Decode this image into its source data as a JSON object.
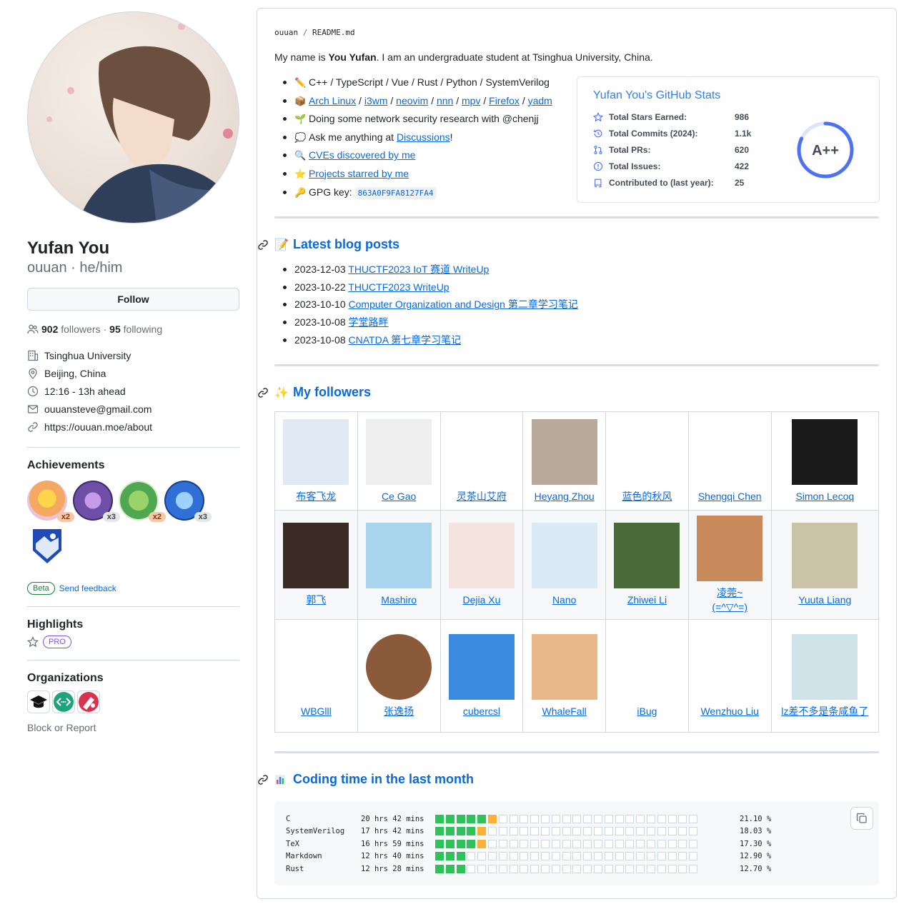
{
  "profile": {
    "name": "Yufan You",
    "username_pronouns": "ouuan · he/him",
    "follow_label": "Follow",
    "followers_count": "902",
    "followers_label": "followers",
    "separator": "·",
    "following_count": "95",
    "following_label": "following",
    "organization": "Tsinghua University",
    "location": "Beijing, China",
    "local_time": "12:16 - 13h ahead",
    "email": "ouuansteve@gmail.com",
    "website": "https://ouuan.moe/about"
  },
  "achievements": {
    "title": "Achievements",
    "badges": [
      {
        "name": "starstruck",
        "count": "x2",
        "color": "#f8c27a"
      },
      {
        "name": "galaxy-brain",
        "count": "x3",
        "color": "#7d5fb8"
      },
      {
        "name": "pair-extraordinaire",
        "count": "x2",
        "color": "#6cc26d"
      },
      {
        "name": "pull-shark",
        "count": "x3",
        "color": "#3a78d6"
      },
      {
        "name": "arctic-code-vault",
        "count": "",
        "color": "#2a61c7"
      }
    ],
    "beta_label": "Beta",
    "feedback_label": "Send feedback"
  },
  "highlights": {
    "title": "Highlights",
    "pro_label": "PRO"
  },
  "organizations": {
    "title": "Organizations",
    "block_label": "Block or Report"
  },
  "readme": {
    "path_user": "ouuan",
    "path_sep": "/",
    "path_file": "README.md",
    "intro_pre": "My name is ",
    "intro_name": "You Yufan",
    "intro_post": ". I am an undergraduate student at Tsinghua University, China.",
    "langs": "C++ / TypeScript / Vue / Rust / Python / SystemVerilog",
    "tools": [
      "Arch Linux",
      "i3wm",
      "neovim",
      "nnn",
      "mpv",
      "Firefox",
      "yadm"
    ],
    "tools_sep": " / ",
    "research": "Doing some network security research with @chenjj",
    "ask_pre": "Ask me anything at ",
    "ask_link": "Discussions",
    "ask_post": "!",
    "cves": "CVEs discovered by me",
    "starred": "Projects starred by me",
    "gpg_label": "GPG key: ",
    "gpg_key": "863A0F9FA8127FA4"
  },
  "stats_card": {
    "title": "Yufan You's GitHub Stats",
    "rows": [
      {
        "label": "Total Stars Earned:",
        "value": "986",
        "icon": "star-icon"
      },
      {
        "label": "Total Commits (2024):",
        "value": "1.1k",
        "icon": "history-icon"
      },
      {
        "label": "Total PRs:",
        "value": "620",
        "icon": "pull-request-icon"
      },
      {
        "label": "Total Issues:",
        "value": "422",
        "icon": "issue-icon"
      },
      {
        "label": "Contributed to (last year):",
        "value": "25",
        "icon": "repo-icon"
      }
    ],
    "grade": "A++",
    "ring_progress": 0.82
  },
  "blog": {
    "title": "Latest blog posts",
    "posts": [
      {
        "date": "2023-12-03",
        "title": "THUCTF2023 IoT 赛道 WriteUp"
      },
      {
        "date": "2023-10-22",
        "title": "THUCTF2023 WriteUp"
      },
      {
        "date": "2023-10-10",
        "title": "Computer Organization and Design 第二章学习笔记"
      },
      {
        "date": "2023-10-08",
        "title": "学堂路畔"
      },
      {
        "date": "2023-10-08",
        "title": "CNATDA 第七章学习笔记"
      }
    ]
  },
  "followers": {
    "title": "My followers",
    "rows": [
      [
        {
          "name": "布客飞龙",
          "bg": "#dfeaf5",
          "shape": "square"
        },
        {
          "name": "Ce Gao",
          "bg": "#eeeeee",
          "shape": "square"
        },
        {
          "name": "灵茶山艾府",
          "bg": "#ffffff",
          "shape": "square"
        },
        {
          "name": "Heyang Zhou",
          "bg": "#b9a99a",
          "shape": "square"
        },
        {
          "name": "蓝色的秋风",
          "bg": "#ffffff",
          "shape": "square"
        },
        {
          "name": "Shengqi Chen",
          "bg": "#ffffff",
          "shape": "square"
        },
        {
          "name": "Simon Lecoq",
          "bg": "#1a1a1a",
          "shape": "square"
        }
      ],
      [
        {
          "name": "郭飞",
          "bg": "#3a2a25",
          "shape": "square"
        },
        {
          "name": "Mashiro",
          "bg": "#a9d4ee",
          "shape": "square"
        },
        {
          "name": "Dejia Xu",
          "bg": "#f3e4e0",
          "shape": "square"
        },
        {
          "name": "Nano",
          "bg": "#dceaf5",
          "shape": "square"
        },
        {
          "name": "Zhiwei Li",
          "bg": "#4a6a3a",
          "shape": "square"
        },
        {
          "name": "凌莞~\n(=^▽^=)",
          "bg": "#c88a5a",
          "shape": "square"
        },
        {
          "name": "Yuuta Liang",
          "bg": "#c9c3a8",
          "shape": "square"
        }
      ],
      [
        {
          "name": "WBGlll",
          "bg": "#ffffff",
          "shape": "square"
        },
        {
          "name": "张逸扬",
          "bg": "#8a5a3a",
          "shape": "circle"
        },
        {
          "name": "cubercsl",
          "bg": "#3a8be0",
          "shape": "square"
        },
        {
          "name": "WhaleFall",
          "bg": "#e9b88a",
          "shape": "square"
        },
        {
          "name": "iBug",
          "bg": "#ffffff",
          "shape": "square"
        },
        {
          "name": "Wenzhuo Liu",
          "bg": "#ffffff",
          "shape": "square"
        },
        {
          "name": "lz差不多是条咸鱼了",
          "bg": "#cfe3e8",
          "shape": "square"
        }
      ]
    ]
  },
  "coding": {
    "title": "Coding time in the last month",
    "langs": [
      {
        "lang": "C",
        "time": "20 hrs 42 mins",
        "pct": "21.10 %",
        "green": 5,
        "orange": 1
      },
      {
        "lang": "SystemVerilog",
        "time": "17 hrs 42 mins",
        "pct": "18.03 %",
        "green": 4,
        "orange": 1
      },
      {
        "lang": "TeX",
        "time": "16 hrs 59 mins",
        "pct": "17.30 %",
        "green": 4,
        "orange": 1
      },
      {
        "lang": "Markdown",
        "time": "12 hrs 40 mins",
        "pct": "12.90 %",
        "green": 3,
        "orange": 0
      },
      {
        "lang": "Rust",
        "time": "12 hrs 28 mins",
        "pct": "12.70 %",
        "green": 3,
        "orange": 0
      }
    ],
    "cells_total": 25
  }
}
